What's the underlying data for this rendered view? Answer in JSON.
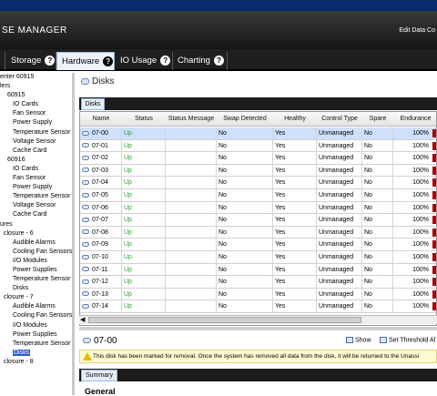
{
  "header": {
    "brand": "SE MANAGER",
    "edit_link": "Edit Data Co"
  },
  "tabs": [
    {
      "label": "Storage"
    },
    {
      "label": "Hardware"
    },
    {
      "label": "IO Usage"
    },
    {
      "label": "Charting"
    }
  ],
  "tree": [
    "enter 60915",
    "lers",
    "60915",
    "IO Cards",
    "Fan Sensor",
    "Power Supply",
    "Temperature Sensor",
    "Voltage Sensor",
    "Cache Card",
    "60916",
    "IO Cards",
    "Fan Sensor",
    "Power Supply",
    "Temperature Sensor",
    "Voltage Sensor",
    "Cache Card",
    "ures",
    "closure - 6",
    "Audible Alarms",
    "Cooling Fan Sensors",
    "I/O Modules",
    "Power Supplies",
    "Temperature Sensor",
    "Disks",
    "closure - 7",
    "Audible Alarms",
    "Cooling Fan Sensors",
    "I/O Modules",
    "Power Supplies",
    "Temperature Sensor",
    "Disks",
    "closure - 8"
  ],
  "tree_selected_index": 30,
  "main": {
    "title": "Disks",
    "subtab": "Disks"
  },
  "columns": [
    "Name",
    "Status",
    "Status Message",
    "Swap Detected",
    "Healthy",
    "Control Type",
    "Spare",
    "Endurance"
  ],
  "rows": [
    {
      "name": "07-00",
      "status": "Up",
      "msg": "",
      "swap": "No",
      "healthy": "Yes",
      "ctype": "Unmanaged",
      "spare": "No",
      "endurance": "100%"
    },
    {
      "name": "07-01",
      "status": "Up",
      "msg": "",
      "swap": "No",
      "healthy": "Yes",
      "ctype": "Unmanaged",
      "spare": "No",
      "endurance": "100%"
    },
    {
      "name": "07-02",
      "status": "Up",
      "msg": "",
      "swap": "No",
      "healthy": "Yes",
      "ctype": "Unmanaged",
      "spare": "No",
      "endurance": "100%"
    },
    {
      "name": "07-03",
      "status": "Up",
      "msg": "",
      "swap": "No",
      "healthy": "Yes",
      "ctype": "Unmanaged",
      "spare": "No",
      "endurance": "100%"
    },
    {
      "name": "07-04",
      "status": "Up",
      "msg": "",
      "swap": "No",
      "healthy": "Yes",
      "ctype": "Unmanaged",
      "spare": "No",
      "endurance": "100%"
    },
    {
      "name": "07-05",
      "status": "Up",
      "msg": "",
      "swap": "No",
      "healthy": "Yes",
      "ctype": "Unmanaged",
      "spare": "No",
      "endurance": "100%"
    },
    {
      "name": "07-06",
      "status": "Up",
      "msg": "",
      "swap": "No",
      "healthy": "Yes",
      "ctype": "Unmanaged",
      "spare": "No",
      "endurance": "100%"
    },
    {
      "name": "07-07",
      "status": "Up",
      "msg": "",
      "swap": "No",
      "healthy": "Yes",
      "ctype": "Unmanaged",
      "spare": "No",
      "endurance": "100%"
    },
    {
      "name": "07-08",
      "status": "Up",
      "msg": "",
      "swap": "No",
      "healthy": "Yes",
      "ctype": "Unmanaged",
      "spare": "No",
      "endurance": "100%"
    },
    {
      "name": "07-09",
      "status": "Up",
      "msg": "",
      "swap": "No",
      "healthy": "Yes",
      "ctype": "Unmanaged",
      "spare": "No",
      "endurance": "100%"
    },
    {
      "name": "07-10",
      "status": "Up",
      "msg": "",
      "swap": "No",
      "healthy": "Yes",
      "ctype": "Unmanaged",
      "spare": "No",
      "endurance": "100%"
    },
    {
      "name": "07-11",
      "status": "Up",
      "msg": "",
      "swap": "No",
      "healthy": "Yes",
      "ctype": "Unmanaged",
      "spare": "No",
      "endurance": "100%"
    },
    {
      "name": "07-12",
      "status": "Up",
      "msg": "",
      "swap": "No",
      "healthy": "Yes",
      "ctype": "Unmanaged",
      "spare": "No",
      "endurance": "100%"
    },
    {
      "name": "07-13",
      "status": "Up",
      "msg": "",
      "swap": "No",
      "healthy": "Yes",
      "ctype": "Unmanaged",
      "spare": "No",
      "endurance": "100%"
    },
    {
      "name": "07-14",
      "status": "Up",
      "msg": "",
      "swap": "No",
      "healthy": "Yes",
      "ctype": "Unmanaged",
      "spare": "No",
      "endurance": "100%"
    }
  ],
  "selected_row_index": 0,
  "detail": {
    "title": "07-00",
    "show_label": "Show",
    "threshold_label": "Set Threshold Al",
    "warning": "This disk has been marked for removal. Once the system has removed all data from the disk, it will be returned to the Unassi",
    "summary_tab": "Summary",
    "section": "General"
  },
  "colors": {
    "status_up": "#2a9d2a",
    "selection": "#cfe0fb",
    "endurance_bar": "#b00000",
    "header_bg": "#151515"
  }
}
